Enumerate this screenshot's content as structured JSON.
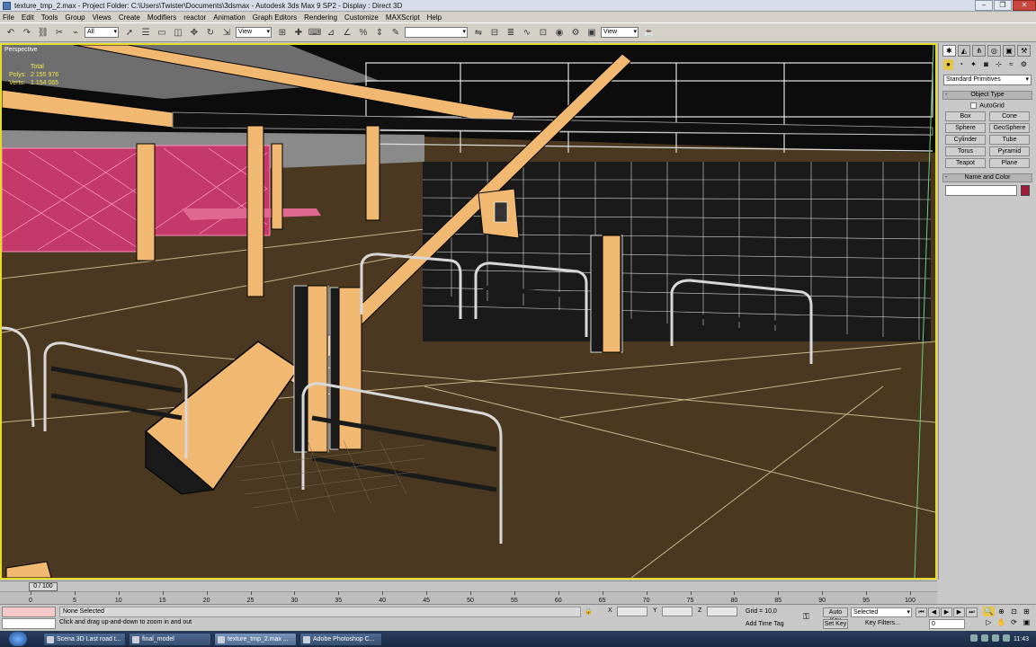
{
  "window": {
    "title": "texture_tmp_2.max    - Project Folder: C:\\Users\\Twister\\Documents\\3dsmax    - Autodesk 3ds Max 9 SP2    - Display : Direct 3D",
    "buttons": {
      "minimize": "–",
      "maximize": "❐",
      "close": "✕"
    }
  },
  "menu": [
    "File",
    "Edit",
    "Tools",
    "Group",
    "Views",
    "Create",
    "Modifiers",
    "reactor",
    "Animation",
    "Graph Editors",
    "Rendering",
    "Customize",
    "MAXScript",
    "Help"
  ],
  "toolbar": {
    "selection_filter": "All",
    "ref_coord": "View",
    "named_selection": "",
    "view_dropdown": "View"
  },
  "viewport": {
    "label": "Perspective",
    "stats": {
      "header": "Total",
      "polys_label": "Polys:",
      "polys": "2 155 976",
      "verts_label": "Verts:",
      "verts": "1 154 065"
    }
  },
  "command_panel": {
    "category": "Standard Primitives",
    "object_type_title": "Object Type",
    "autogrid_label": "AutoGrid",
    "primitives": [
      "Box",
      "Cone",
      "Sphere",
      "GeoSphere",
      "Cylinder",
      "Tube",
      "Torus",
      "Pyramid",
      "Teapot",
      "Plane"
    ],
    "name_color_title": "Name and Color",
    "object_color": "#a0183a"
  },
  "time": {
    "slider_label": "0 / 100",
    "ticks": [
      "0",
      "5",
      "10",
      "15",
      "20",
      "25",
      "30",
      "35",
      "40",
      "45",
      "50",
      "55",
      "60",
      "65",
      "70",
      "75",
      "80",
      "85",
      "90",
      "95",
      "100"
    ]
  },
  "status": {
    "selection": "None Selected",
    "prompt": "Click and drag up-and-down to zoom in and out",
    "x_label": "X",
    "y_label": "Y",
    "z_label": "Z",
    "grid": "Grid = 10,0",
    "add_time_tag": "Add Time Tag",
    "auto_key": "Auto Key",
    "set_key": "Set Key",
    "key_mode": "Selected",
    "key_filters": "Key Filters...",
    "current_frame": "0"
  },
  "taskbar": {
    "tasks": [
      "Scena 3D Last road t...",
      "final_model",
      "texture_tmp_2.max ...",
      "Adobe Photoshop C..."
    ],
    "active_index": 2,
    "clock": "11:43"
  }
}
